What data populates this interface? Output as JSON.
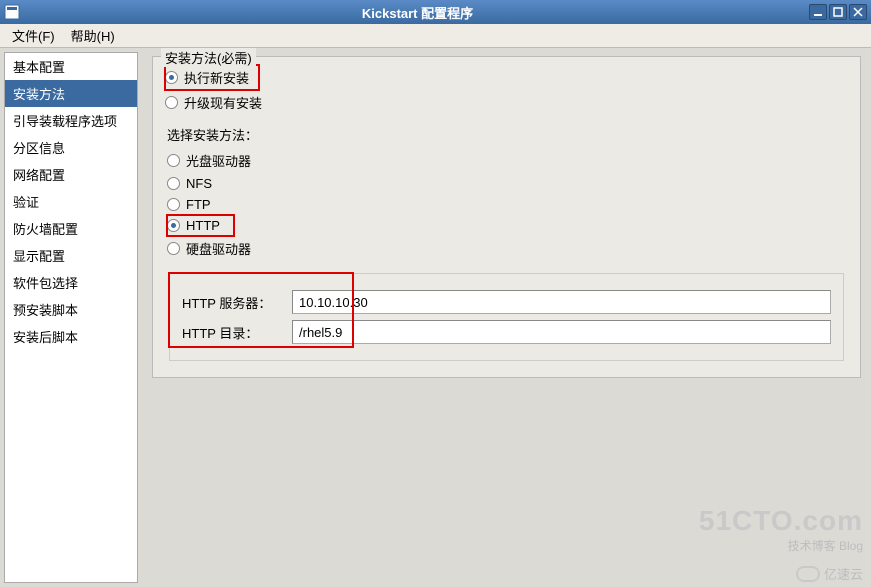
{
  "window": {
    "title": "Kickstart 配置程序"
  },
  "menubar": {
    "file": "文件(F)",
    "help": "帮助(H)"
  },
  "sidebar": {
    "items": [
      {
        "label": "基本配置"
      },
      {
        "label": "安装方法"
      },
      {
        "label": "引导装载程序选项"
      },
      {
        "label": "分区信息"
      },
      {
        "label": "网络配置"
      },
      {
        "label": "验证"
      },
      {
        "label": "防火墙配置"
      },
      {
        "label": "显示配置"
      },
      {
        "label": "软件包选择"
      },
      {
        "label": "预安装脚本"
      },
      {
        "label": "安装后脚本"
      }
    ],
    "selected_index": 1
  },
  "main": {
    "install_method_legend": "安装方法(必需)",
    "install_type": {
      "new_install": "执行新安装",
      "upgrade": "升级现有安装",
      "selected": "new_install"
    },
    "choose_method_label": "选择安装方法：",
    "methods": {
      "cdrom": "光盘驱动器",
      "nfs": "NFS",
      "ftp": "FTP",
      "http": "HTTP",
      "harddrive": "硬盘驱动器",
      "selected": "http"
    },
    "http": {
      "server_label": "HTTP 服务器：",
      "server_value": "10.10.10.30",
      "dir_label": "HTTP 目录：",
      "dir_value": "/rhel5.9"
    }
  },
  "watermark": {
    "line1": "51CTO.com",
    "line2": "技术博客 Blog",
    "line3": "亿速云"
  }
}
